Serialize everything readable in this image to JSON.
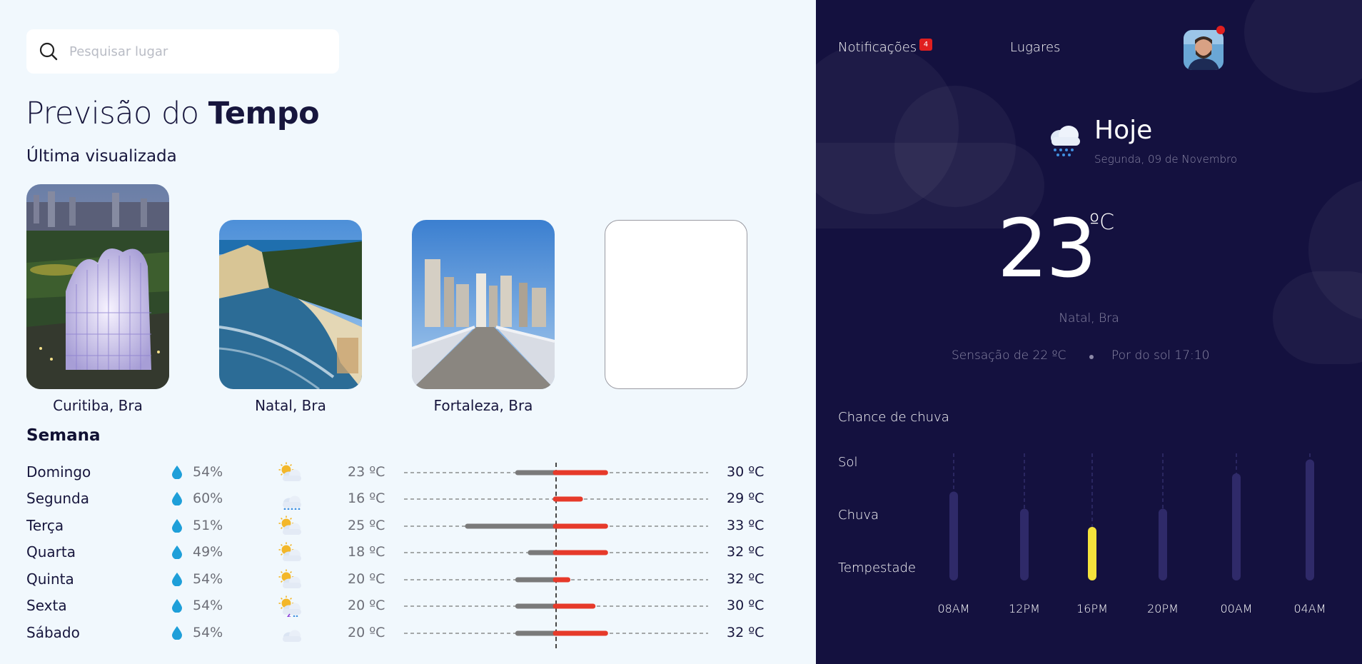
{
  "search": {
    "placeholder": "Pesquisar lugar"
  },
  "page": {
    "title_light": "Previsão do ",
    "title_bold": "Tempo",
    "subtitle": "Última visualizada"
  },
  "recent": [
    {
      "name": "Curitiba, Bra",
      "scene": "curitiba"
    },
    {
      "name": "Natal, Bra",
      "scene": "natal"
    },
    {
      "name": "Fortaleza, Bra",
      "scene": "fortaleza"
    },
    {
      "name": "",
      "scene": "empty"
    }
  ],
  "week": {
    "title": "Semana",
    "days": [
      {
        "day": "Domingo",
        "rain": "54%",
        "icon": "partly-cloudy-icon",
        "min_label": "23 ºC",
        "max_label": "30 ºC",
        "bar_min": 23,
        "bar_max": 30
      },
      {
        "day": "Segunda",
        "rain": "60%",
        "icon": "rain-icon",
        "min_label": "16 ºC",
        "max_label": "29 ºC",
        "bar_min": 26,
        "bar_max": 28
      },
      {
        "day": "Terça",
        "rain": "51%",
        "icon": "partly-cloudy-icon",
        "min_label": "25 ºC",
        "max_label": "33 ºC",
        "bar_min": 19,
        "bar_max": 30
      },
      {
        "day": "Quarta",
        "rain": "49%",
        "icon": "partly-cloudy-icon",
        "min_label": "18 ºC",
        "max_label": "32 ºC",
        "bar_min": 24,
        "bar_max": 30
      },
      {
        "day": "Quinta",
        "rain": "54%",
        "icon": "partly-cloudy-icon",
        "min_label": "20 ºC",
        "max_label": "32 ºC",
        "bar_min": 23,
        "bar_max": 27
      },
      {
        "day": "Sexta",
        "rain": "54%",
        "icon": "storm-sun-icon",
        "min_label": "20 ºC",
        "max_label": "30 ºC",
        "bar_min": 23,
        "bar_max": 29
      },
      {
        "day": "Sábado",
        "rain": "54%",
        "icon": "cloud-icon",
        "min_label": "20 ºC",
        "max_label": "32 ºC",
        "bar_min": 23,
        "bar_max": 30
      }
    ],
    "bar_scale": {
      "min": 12,
      "max": 38,
      "center": 26
    }
  },
  "header": {
    "notifications_label": "Notificações",
    "notifications_count": "4",
    "places_label": "Lugares"
  },
  "today": {
    "label": "Hoje",
    "date": "Segunda, 09 de Novembro",
    "temp": "23",
    "unit": "ºC",
    "location": "Natal, Bra",
    "feels_like": "Sensação de 22 ºC",
    "sunset": "Por do sol 17:10",
    "icon": "rain-icon"
  },
  "rain_chance": {
    "title": "Chance de chuva",
    "levels": [
      "Sol",
      "Chuva",
      "Tempestade"
    ]
  },
  "chart_data": {
    "type": "bar",
    "title": "Chance de chuva",
    "categories": [
      "08AM",
      "12PM",
      "16PM",
      "20PM",
      "00AM",
      "04AM"
    ],
    "values": [
      0.83,
      0.67,
      0.5,
      0.67,
      1.0,
      1.13
    ],
    "highlight_index": 2,
    "colors": {
      "bar": "#2f2a69",
      "highlight": "#f4e23c"
    }
  },
  "colors": {
    "accent_red": "#e63a2a",
    "bar_gray": "#7a7a7a",
    "panel": "#14113f",
    "drop": "#1e9fd9"
  }
}
